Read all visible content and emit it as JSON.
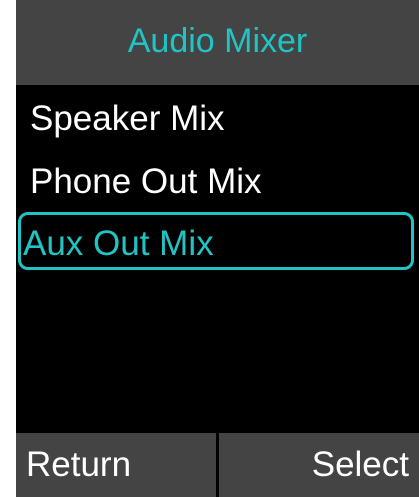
{
  "header": {
    "title": "Audio Mixer"
  },
  "menu": {
    "items": [
      {
        "label": "Speaker Mix",
        "selected": false
      },
      {
        "label": "Phone Out Mix",
        "selected": false
      },
      {
        "label": "Aux Out Mix",
        "selected": true
      }
    ]
  },
  "softkeys": {
    "left_label": "Return",
    "right_label": "Select"
  },
  "colors": {
    "accent": "#20c4c4",
    "bar_background": "#444444",
    "screen_background": "#000000",
    "text": "#ffffff"
  }
}
